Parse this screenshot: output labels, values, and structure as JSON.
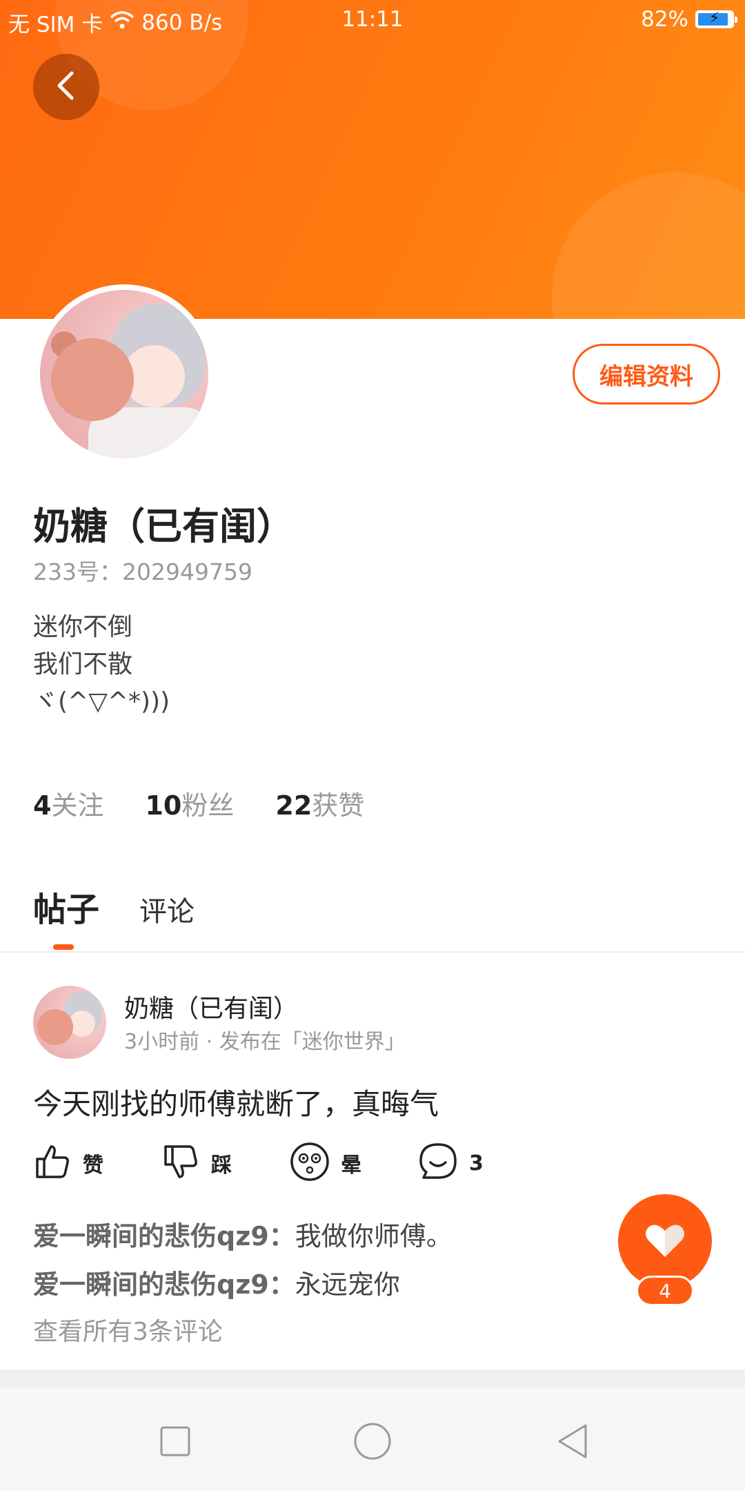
{
  "status_bar": {
    "carrier": "无 SIM 卡",
    "net_speed": "860 B/s",
    "time": "11:11",
    "battery": "82%",
    "battery_level": 0.82
  },
  "colors": {
    "accent": "#ff5a14",
    "banner": "#ff7a10"
  },
  "header": {
    "back_icon": "chevron-left-icon",
    "edit_profile_label": "编辑资料"
  },
  "profile": {
    "name": "奶糖（已有闺）",
    "uid": "233号：202949759",
    "bio_lines": [
      "迷你不倒",
      "我们不散",
      "ヾ(^▽^*)))"
    ],
    "stats": [
      {
        "num": "4",
        "label": "关注"
      },
      {
        "num": "10",
        "label": "粉丝"
      },
      {
        "num": "22",
        "label": "获赞"
      }
    ]
  },
  "tabs": [
    {
      "label": "帖子",
      "active": true
    },
    {
      "label": "评论",
      "active": false
    }
  ],
  "post": {
    "author": "奶糖（已有闺）",
    "meta": "3小时前 · 发布在「迷你世界」",
    "text": "今天刚找的师傅就断了，真晦气",
    "actions": [
      {
        "icon": "thumbs-up-icon",
        "label": "赞"
      },
      {
        "icon": "thumbs-down-icon",
        "label": "踩"
      },
      {
        "icon": "dizzy-face-icon",
        "label": "晕"
      },
      {
        "icon": "comment-bubble-icon",
        "label": "3"
      }
    ],
    "comments": [
      {
        "user": "爱一瞬间的悲伤qz9：",
        "text": "我做你师傅。"
      },
      {
        "user": "爱一瞬间的悲伤qz9：",
        "text": "永远宠你"
      }
    ],
    "see_all": "查看所有3条评论"
  },
  "fab": {
    "icon": "heart-icon",
    "count": "4"
  },
  "nav": {
    "recents_icon": "square-icon",
    "home_icon": "circle-icon",
    "back_icon": "triangle-back-icon"
  }
}
